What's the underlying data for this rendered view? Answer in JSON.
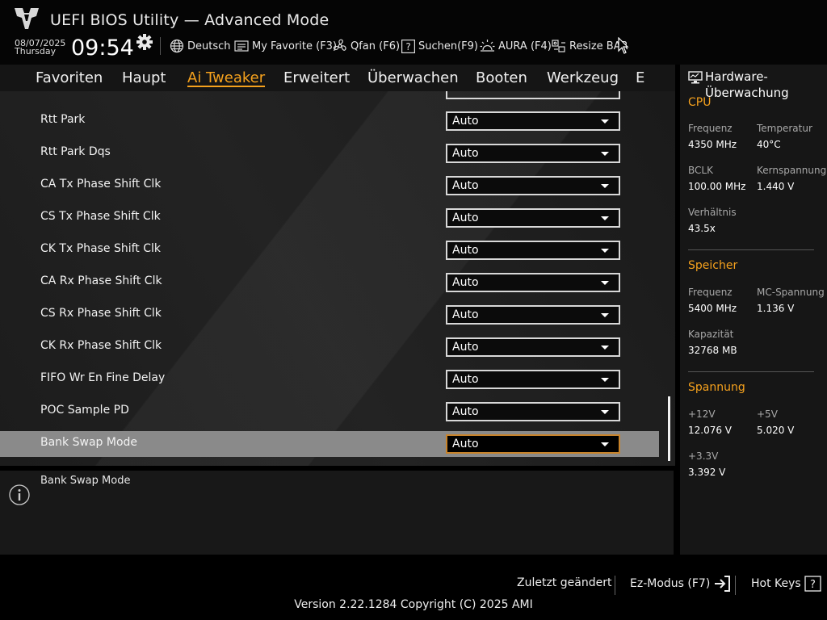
{
  "header": {
    "title": "UEFI BIOS Utility — Advanced Mode",
    "date": "08/07/2025",
    "day": "Thursday",
    "time": "09:54",
    "toolbar": [
      {
        "label": "Deutsch",
        "icon": "globe-icon"
      },
      {
        "label": "My Favorite (F3)",
        "icon": "favorite-icon"
      },
      {
        "label": "Qfan (F6)",
        "icon": "fan-icon"
      },
      {
        "label": "Suchen(F9)",
        "icon": "search-help-icon"
      },
      {
        "label": "AURA (F4)",
        "icon": "aura-icon"
      },
      {
        "label": "Resize BAR",
        "icon": "resize-bar-icon"
      }
    ]
  },
  "tabs": [
    {
      "label": "Favoriten"
    },
    {
      "label": "Haupt"
    },
    {
      "label": "Ai Tweaker",
      "active": true
    },
    {
      "label": "Erweitert"
    },
    {
      "label": "Überwachen"
    },
    {
      "label": "Booten"
    },
    {
      "label": "Werkzeug"
    },
    {
      "label": "E"
    }
  ],
  "settings": [
    {
      "label": "Rtt Park",
      "value": "Auto"
    },
    {
      "label": "Rtt Park Dqs",
      "value": "Auto"
    },
    {
      "label": "CA Tx Phase Shift Clk",
      "value": "Auto"
    },
    {
      "label": "CS Tx Phase Shift Clk",
      "value": "Auto"
    },
    {
      "label": "CK Tx Phase Shift Clk",
      "value": "Auto"
    },
    {
      "label": "CA Rx Phase Shift Clk",
      "value": "Auto"
    },
    {
      "label": "CS Rx Phase Shift Clk",
      "value": "Auto"
    },
    {
      "label": "CK Rx Phase Shift Clk",
      "value": "Auto"
    },
    {
      "label": "FIFO Wr En Fine Delay",
      "value": "Auto"
    },
    {
      "label": "POC Sample PD",
      "value": "Auto"
    },
    {
      "label": "Bank Swap Mode",
      "value": "Auto",
      "selected": true
    }
  ],
  "help": {
    "text": "Bank Swap Mode"
  },
  "hardware_monitor": {
    "title": "Hardware-Überwachung",
    "cpu": {
      "section": "CPU",
      "freq_label": "Frequenz",
      "freq_value": "4350 MHz",
      "temp_label": "Temperatur",
      "temp_value": "40°C",
      "bclk_label": "BCLK",
      "bclk_value": "100.00 MHz",
      "core_label": "Kernspannung",
      "core_value": "1.440 V",
      "ratio_label": "Verhältnis",
      "ratio_value": "43.5x"
    },
    "memory": {
      "section": "Speicher",
      "freq_label": "Frequenz",
      "freq_value": "5400 MHz",
      "mc_label": "MC-Spannung",
      "mc_value": "1.136 V",
      "cap_label": "Kapazität",
      "cap_value": "32768 MB"
    },
    "voltage": {
      "section": "Spannung",
      "v12_label": "+12V",
      "v12_value": "12.076 V",
      "v5_label": "+5V",
      "v5_value": "5.020 V",
      "v33_label": "+3.3V",
      "v33_value": "3.392 V"
    }
  },
  "footer": {
    "last_modified": "Zuletzt geändert",
    "ez_mode": "Ez-Modus (F7)",
    "hot_keys": "Hot Keys",
    "version": "Version 2.22.1284 Copyright (C) 2025 AMI"
  },
  "colors": {
    "accent": "#f5a11d",
    "selected_row": "#8a8a8a",
    "selected_border": "#c8832a"
  }
}
